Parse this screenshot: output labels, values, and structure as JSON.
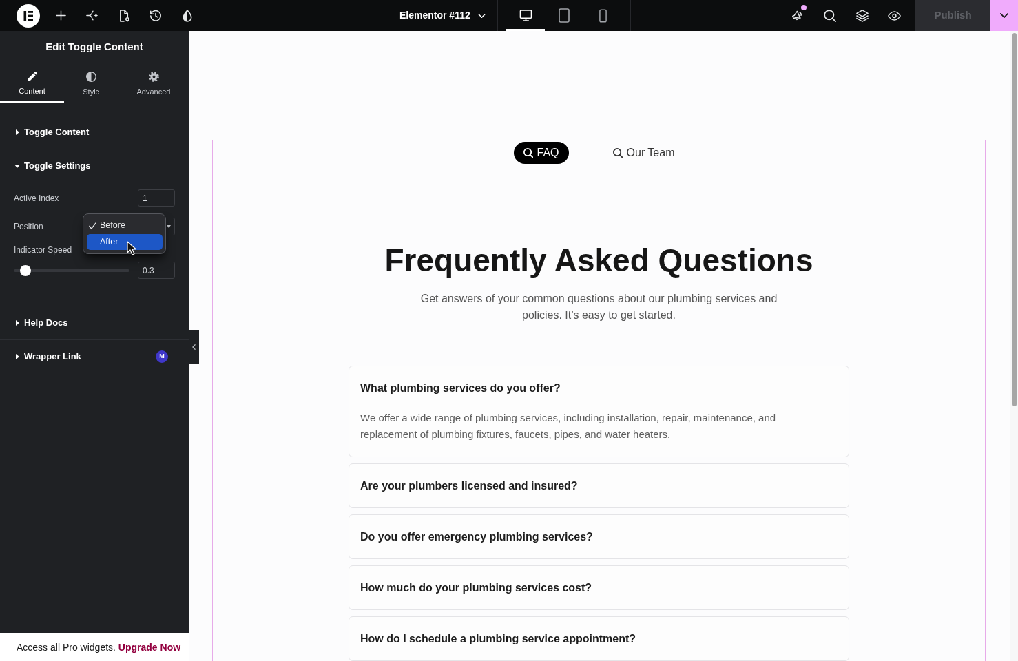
{
  "top_bar": {
    "document_title": "Elementor #112",
    "devices": [
      {
        "kind": "desktop",
        "selected": true
      },
      {
        "kind": "tablet",
        "selected": false
      },
      {
        "kind": "mobile",
        "selected": false
      }
    ],
    "announcements_unread": true,
    "publish_button": {
      "label": "Publish",
      "disabled": true
    }
  },
  "panel": {
    "title": "Edit Toggle Content",
    "tabs": [
      {
        "kind": "content",
        "label": "Content",
        "selected": true
      },
      {
        "kind": "style",
        "label": "Style",
        "selected": false
      },
      {
        "kind": "advanced",
        "label": "Advanced",
        "selected": false
      }
    ],
    "sections": [
      {
        "title": "Toggle Content",
        "expanded": false
      },
      {
        "title": "Toggle Settings",
        "expanded": true,
        "controls": [
          {
            "kind": "number",
            "label": "Active Index",
            "value": "1"
          },
          {
            "kind": "select",
            "label": "Position",
            "menu_open": true,
            "options": [
              {
                "label": "Before",
                "selected": true,
                "highlighted": false
              },
              {
                "label": "After",
                "selected": false,
                "highlighted": true
              }
            ]
          },
          {
            "kind": "slider",
            "label": "Indicator Speed",
            "level": 0.06,
            "value": "0.3"
          }
        ]
      },
      {
        "title": "Help Docs",
        "expanded": false
      },
      {
        "title": "Wrapper Link",
        "expanded": false,
        "badge": "M"
      }
    ],
    "promo": {
      "text": "Access all Pro widgets.",
      "link": "Upgrade Now"
    }
  },
  "canvas": {
    "tabs": [
      {
        "label": "FAQ",
        "selected": true
      },
      {
        "label": "Our Team",
        "selected": false
      }
    ],
    "heading": "Frequently Asked Questions",
    "subtitle": "Get answers of your common questions about our plumbing services and policies. It’s easy to get started.",
    "faqs": [
      {
        "question": "What plumbing services do you offer?",
        "answer": "We offer a wide range of plumbing services, including installation, repair, maintenance, and replacement of plumbing fixtures, faucets, pipes, and water heaters."
      },
      {
        "question": "Are your plumbers licensed and insured?"
      },
      {
        "question": "Do you offer emergency plumbing services?"
      },
      {
        "question": "How much do your plumbing services cost?"
      },
      {
        "question": "How do I schedule a plumbing service appointment?"
      }
    ]
  }
}
